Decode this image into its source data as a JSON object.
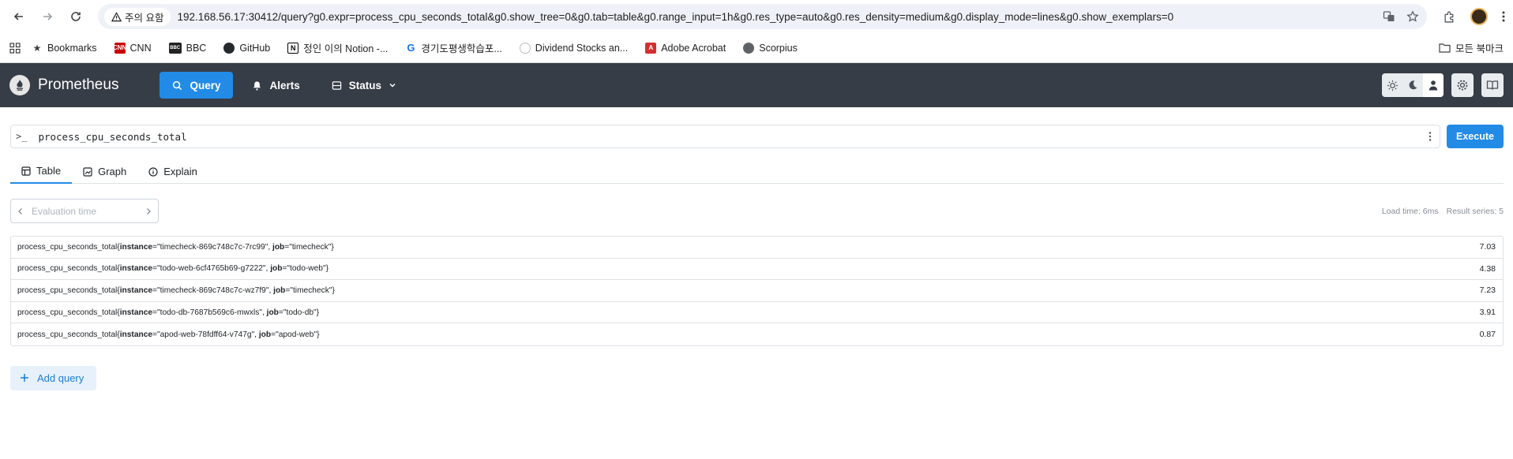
{
  "browser": {
    "warning_label": "주의 요함",
    "url": "192.168.56.17:30412/query?g0.expr=process_cpu_seconds_total&g0.show_tree=0&g0.tab=table&g0.range_input=1h&g0.res_type=auto&g0.res_density=medium&g0.display_mode=lines&g0.show_exemplars=0",
    "bookmarks": [
      "Bookmarks",
      "CNN",
      "BBC",
      "GitHub",
      "정인 이의 Notion -...",
      "경기도평생학습포...",
      "Dividend Stocks an...",
      "Adobe Acrobat",
      "Scorpius"
    ],
    "all_bookmarks": "모든 북마크"
  },
  "app": {
    "title": "Prometheus",
    "nav": {
      "query": "Query",
      "alerts": "Alerts",
      "status": "Status"
    }
  },
  "query": {
    "prompt": ">_",
    "expression": "process_cpu_seconds_total",
    "execute": "Execute",
    "tabs": {
      "table": "Table",
      "graph": "Graph",
      "explain": "Explain"
    },
    "eval_placeholder": "Evaluation time",
    "load_time": "Load time: 6ms",
    "result_series": "Result series: 5"
  },
  "results": [
    {
      "metric": "process_cpu_seconds_total",
      "instance": "timecheck-869c748c7c-7rc99",
      "job": "timecheck",
      "value": "7.03"
    },
    {
      "metric": "process_cpu_seconds_total",
      "instance": "todo-web-6cf4765b69-g7222",
      "job": "todo-web",
      "value": "4.38"
    },
    {
      "metric": "process_cpu_seconds_total",
      "instance": "timecheck-869c748c7c-wz7f9",
      "job": "timecheck",
      "value": "7.23"
    },
    {
      "metric": "process_cpu_seconds_total",
      "instance": "todo-db-7687b569c6-mwxls",
      "job": "todo-db",
      "value": "3.91"
    },
    {
      "metric": "process_cpu_seconds_total",
      "instance": "apod-web-78fdff64-v747g",
      "job": "apod-web",
      "value": "0.87"
    }
  ],
  "add_query": "Add query",
  "colors": {
    "accent": "#228be6",
    "navbar": "#373d46"
  }
}
